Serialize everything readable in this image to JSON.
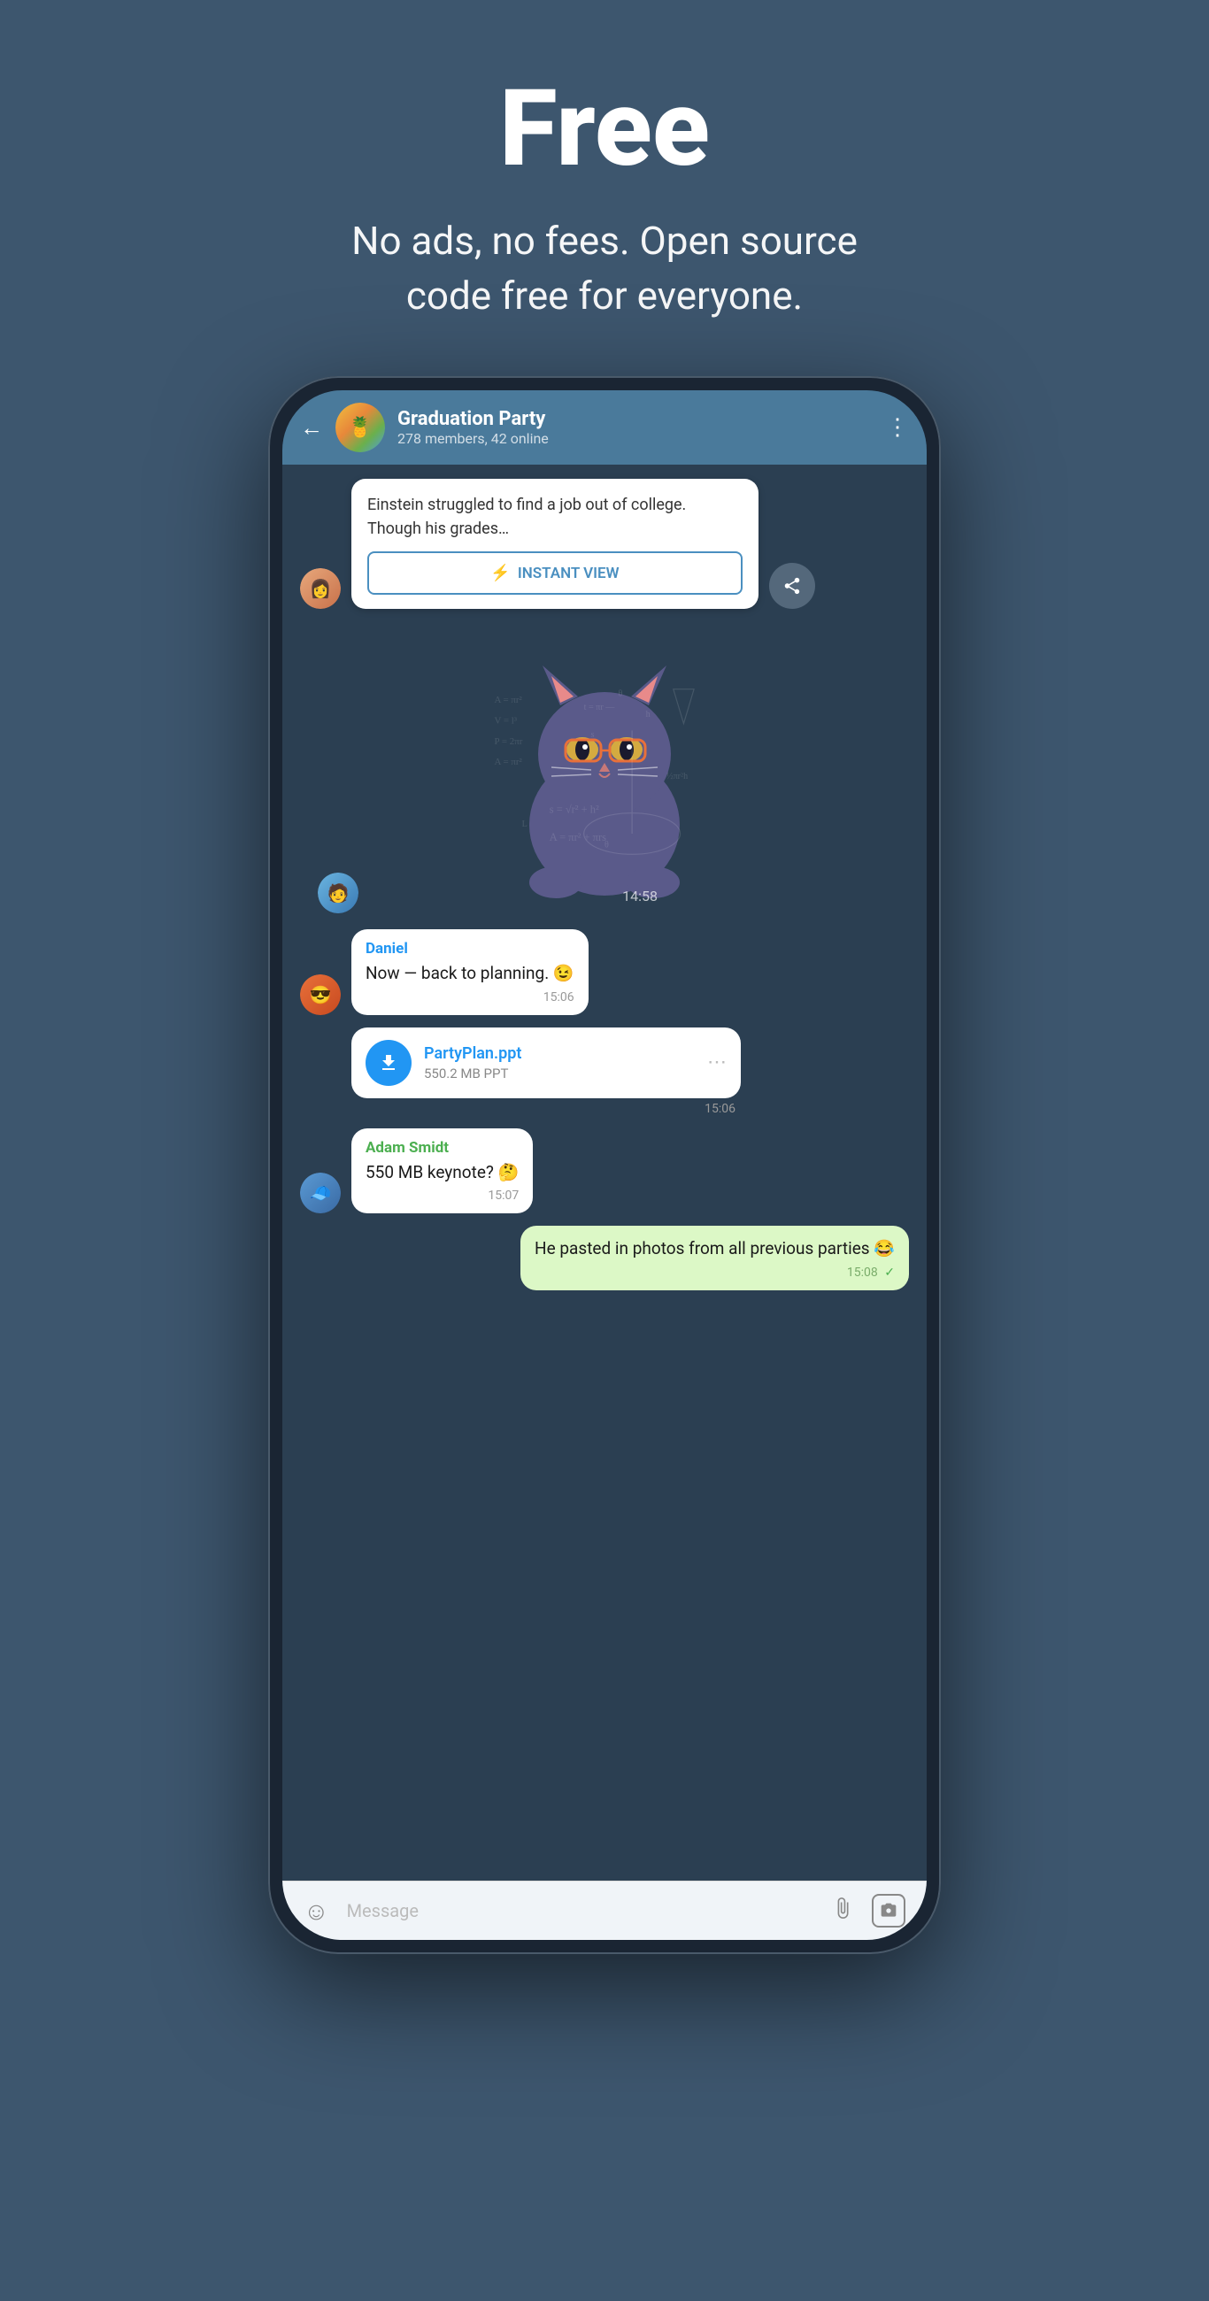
{
  "hero": {
    "title": "Free",
    "subtitle": "No ads, no fees. Open source\ncode free for everyone."
  },
  "phone": {
    "header": {
      "group_name": "Graduation Party",
      "group_meta": "278 members, 42 online",
      "back_label": "←",
      "more_label": "⋮"
    },
    "messages": [
      {
        "id": "article",
        "type": "article",
        "text": "Einstein struggled to find a job out of college. Though his grades...",
        "iv_label": "INSTANT VIEW",
        "iv_icon": "⚡"
      },
      {
        "id": "sticker",
        "type": "sticker",
        "time": "14:58"
      },
      {
        "id": "daniel-msg",
        "type": "text",
        "sender": "Daniel",
        "text": "Now — back to planning. 😉",
        "time": "15:06"
      },
      {
        "id": "file-msg",
        "type": "file",
        "file_name": "PartyPlan.ppt",
        "file_size": "550.2 MB PPT",
        "time": "15:06"
      },
      {
        "id": "adam-msg",
        "type": "text",
        "sender": "Adam Smidt",
        "text": "550 MB keynote? 🤔",
        "time": "15:07"
      },
      {
        "id": "own-msg",
        "type": "own",
        "text": "He pasted in photos from all previous parties 😂",
        "time": "15:08"
      }
    ],
    "input": {
      "placeholder": "Message",
      "emoji_icon": "☺",
      "attach_icon": "🖇",
      "camera_icon": "⬜"
    }
  },
  "colors": {
    "header_bg": "#4a7a9b",
    "chat_bg": "#2b3f52",
    "accent_blue": "#2196F3",
    "bubble_green": "#dcf8c6",
    "page_bg": "#3d566e"
  }
}
